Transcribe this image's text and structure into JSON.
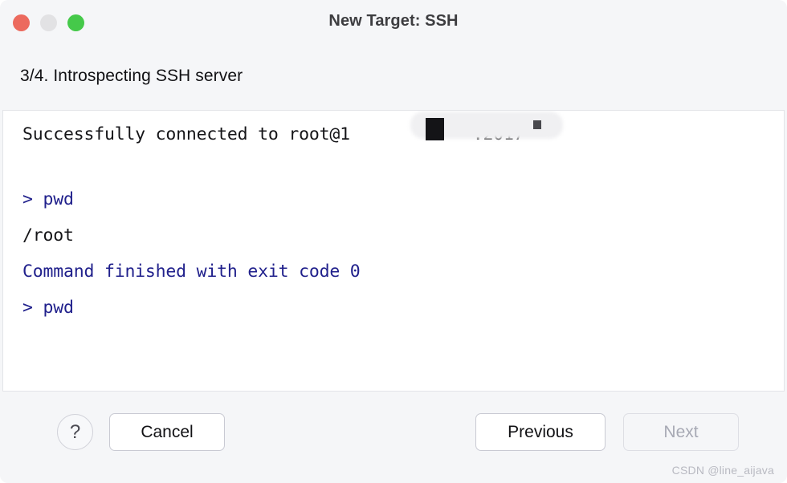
{
  "window": {
    "title": "New Target: SSH",
    "traffic_lights": [
      {
        "name": "close",
        "color": "#ec6a5e"
      },
      {
        "name": "minimize",
        "color": "#e2e2e4"
      },
      {
        "name": "maximize",
        "color": "#45c94a"
      }
    ]
  },
  "wizard": {
    "step_heading": "3/4. Introspecting SSH server"
  },
  "terminal": {
    "lines": [
      {
        "text": "Successfully connected to root@1            :2017",
        "color": "black"
      },
      {
        "text": "> pwd",
        "color": "navy"
      },
      {
        "text": "/root",
        "color": "black"
      },
      {
        "text": "Command finished with exit code 0",
        "color": "navy"
      },
      {
        "text": "> pwd",
        "color": "navy"
      }
    ],
    "redaction_note": "host address redacted"
  },
  "footer": {
    "help_label": "?",
    "cancel_label": "Cancel",
    "previous_label": "Previous",
    "next_label": "Next",
    "next_enabled": false
  },
  "watermark": {
    "text": "CSDN @line_aijava"
  },
  "colors": {
    "background": "#f5f6f8",
    "panel": "#ffffff",
    "terminal_navy": "#21218c",
    "terminal_black": "#151518",
    "disabled_text": "#a7a9b4"
  }
}
